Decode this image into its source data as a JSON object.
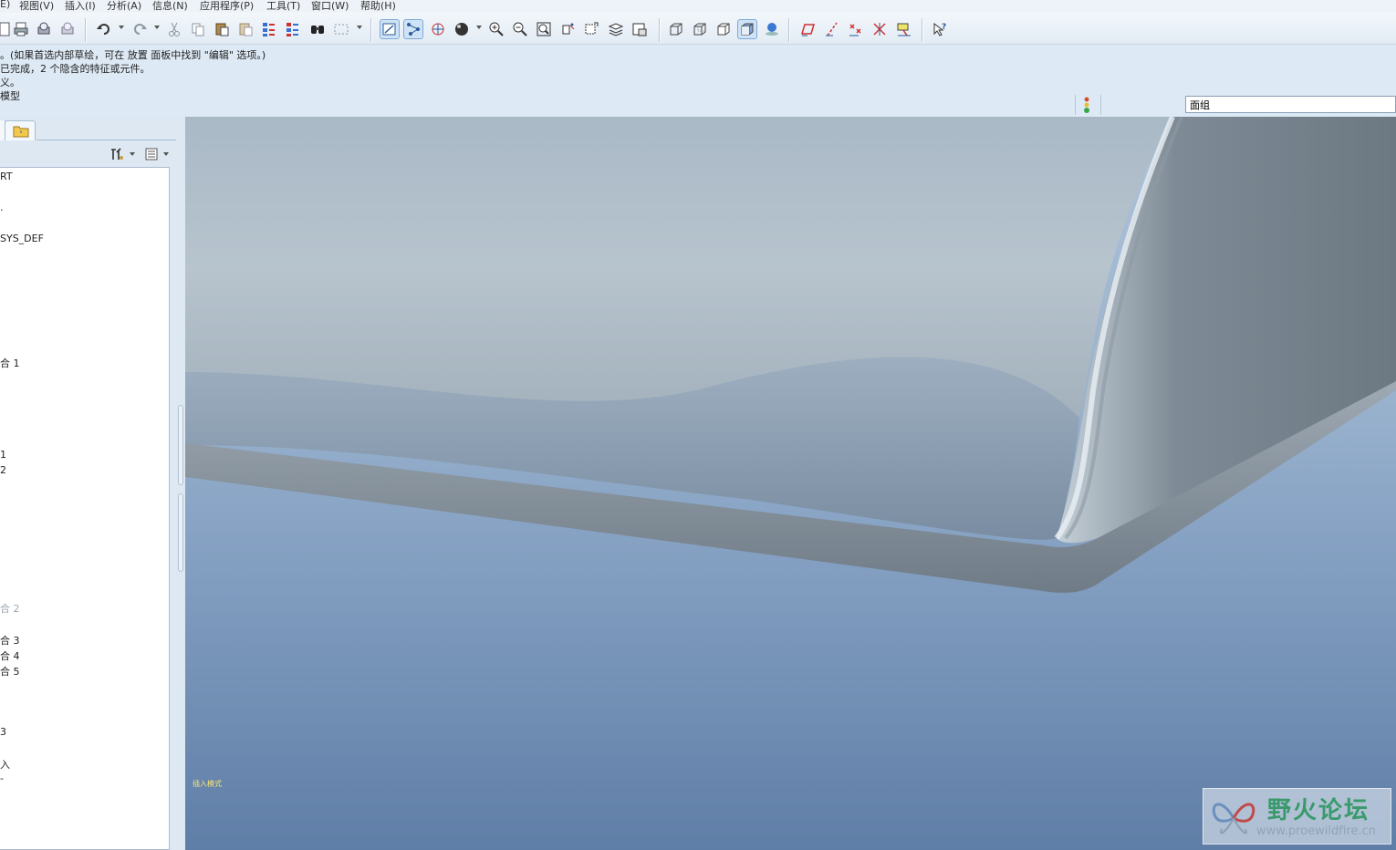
{
  "menu": [
    {
      "label": "E)"
    },
    {
      "label": "视图(V)"
    },
    {
      "label": "插入(I)"
    },
    {
      "label": "分析(A)"
    },
    {
      "label": "信息(N)"
    },
    {
      "label": "应用程序(P)"
    },
    {
      "label": "工具(T)"
    },
    {
      "label": "窗口(W)"
    },
    {
      "label": "帮助(H)"
    }
  ],
  "toolbar": {
    "icons": [
      "new-icon",
      "print-icon",
      "print-preview-icon",
      "mail-icon",
      "undo-icon",
      "redo-icon",
      "cut-icon",
      "copy-icon",
      "paste-icon",
      "paste-special-icon",
      "regenerate-icon",
      "regen-manager-icon",
      "find-icon",
      "select-box-icon",
      "datum-plane-display-icon",
      "datum-axis-display-icon",
      "spin-center-icon",
      "shading-style-icon",
      "zoom-in-icon",
      "zoom-out-icon",
      "refit-icon",
      "reorient-icon",
      "saved-views-icon",
      "layers-icon",
      "view-manager-icon",
      "wireframe-icon",
      "hidden-line-icon",
      "no-hidden-icon",
      "shading-icon",
      "enhanced-realism-icon",
      "plane-display-icon",
      "axis-display-icon",
      "point-display-icon",
      "csys-display-icon",
      "annotation-display-icon",
      "context-help-icon"
    ]
  },
  "messages": [
    "。(如果首选内部草绘，可在 放置 面板中找到 \"编辑\" 选项。)",
    "已完成，2 个隐含的特征或元件。",
    "义。",
    "模型"
  ],
  "filter": {
    "value": "面组"
  },
  "status_light_colors": {
    "top": "#d94a2a",
    "mid": "#e5c02a",
    "bottom": "#37a845"
  },
  "navigator": {
    "tree": [
      {
        "label": "RT",
        "dim": false
      },
      {
        "label": ".",
        "dim": false
      },
      {
        "label": "SYS_DEF",
        "dim": false
      },
      {
        "label": "合 1",
        "dim": false
      },
      {
        "label": "1",
        "dim": false
      },
      {
        "label": "2",
        "dim": false
      },
      {
        "label": "合 2",
        "dim": true
      },
      {
        "label": "合 3",
        "dim": false
      },
      {
        "label": "合 4",
        "dim": false
      },
      {
        "label": "合 5",
        "dim": false
      },
      {
        "label": "3",
        "dim": false
      },
      {
        "label": "入",
        "dim": false
      },
      {
        "label": "-",
        "dim": false
      }
    ]
  },
  "graphics": {
    "mode_label": "插入模式"
  },
  "watermark": {
    "title": "野火论坛",
    "url": "www.proewildfire.cn"
  }
}
